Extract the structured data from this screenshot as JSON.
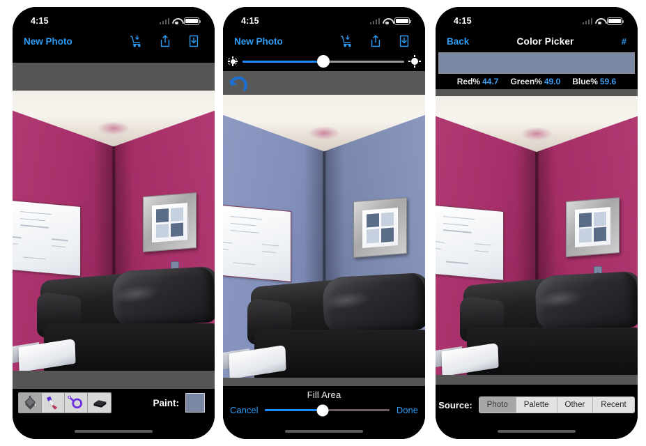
{
  "app": {
    "status_time": "4:15"
  },
  "colors": {
    "accent_blue": "#2f9cf4",
    "paint_swatch": "#7b88a4",
    "wall_original": "#a32a67",
    "wall_painted": "#7f8cb4",
    "toolbar_gray": "#555555"
  },
  "phone1": {
    "nav": {
      "title": "New Photo",
      "icons": [
        "cart-download-icon",
        "share-icon",
        "save-download-icon"
      ]
    },
    "tools": [
      {
        "name": "paint-bucket-tool",
        "selected": true
      },
      {
        "name": "paint-brush-tool",
        "selected": false
      },
      {
        "name": "magic-select-tool",
        "selected": false
      },
      {
        "name": "eraser-tool",
        "selected": false
      }
    ],
    "paint_label": "Paint:",
    "paint_color": "#7b88a4"
  },
  "phone2": {
    "nav": {
      "title": "New Photo",
      "icons": [
        "cart-download-icon",
        "share-icon",
        "save-download-icon"
      ]
    },
    "brightness": {
      "value_percent": 50,
      "left_icon": "sun-dim-icon",
      "right_icon": "sun-bright-icon"
    },
    "undo_icon": "undo-arrow-icon",
    "fill": {
      "title": "Fill Area",
      "cancel_label": "Cancel",
      "done_label": "Done",
      "value_percent": 46
    }
  },
  "phone3": {
    "nav": {
      "back_label": "Back",
      "title": "Color Picker",
      "hash_label": "#"
    },
    "preview_color": "#7b88a4",
    "channels": [
      {
        "label": "Red%",
        "value": "44.7"
      },
      {
        "label": "Green%",
        "value": "49.0"
      },
      {
        "label": "Blue%",
        "value": "59.6"
      }
    ],
    "source": {
      "label": "Source:",
      "options": [
        "Photo",
        "Palette",
        "Other",
        "Recent"
      ],
      "selected": "Photo"
    }
  }
}
